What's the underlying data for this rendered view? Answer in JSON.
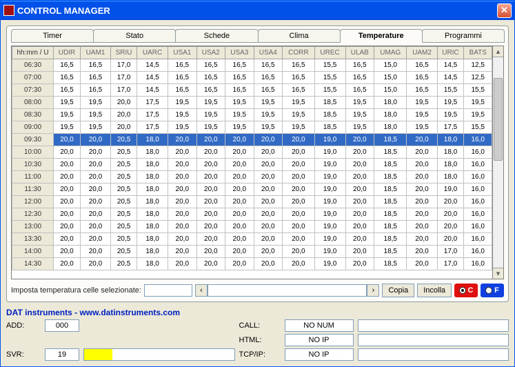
{
  "window": {
    "title": "CONTROL MANAGER"
  },
  "tabs": [
    "Timer",
    "Stato",
    "Schede",
    "Clima",
    "Temperature",
    "Programmi"
  ],
  "active_tab": 4,
  "columns": [
    "hh:mm / U",
    "UDIR",
    "UAM1",
    "SRIU",
    "UARC",
    "USA1",
    "USA2",
    "USA3",
    "USA4",
    "CORR",
    "UREC",
    "ULAB",
    "UMAG",
    "UAM2",
    "URIC",
    "BATS"
  ],
  "selected_row": 6,
  "rows": [
    {
      "t": "06:30",
      "v": [
        "16,5",
        "16,5",
        "17,0",
        "14,5",
        "16,5",
        "16,5",
        "16,5",
        "16,5",
        "16,5",
        "15,5",
        "16,5",
        "15,0",
        "16,5",
        "14,5",
        "12,5"
      ]
    },
    {
      "t": "07:00",
      "v": [
        "16,5",
        "16,5",
        "17,0",
        "14,5",
        "16,5",
        "16,5",
        "16,5",
        "16,5",
        "16,5",
        "15,5",
        "16,5",
        "15,0",
        "16,5",
        "14,5",
        "12,5"
      ]
    },
    {
      "t": "07:30",
      "v": [
        "16,5",
        "16,5",
        "17,0",
        "14,5",
        "16,5",
        "16,5",
        "16,5",
        "16,5",
        "16,5",
        "15,5",
        "16,5",
        "15,0",
        "16,5",
        "15,5",
        "15,5"
      ]
    },
    {
      "t": "08:00",
      "v": [
        "19,5",
        "19,5",
        "20,0",
        "17,5",
        "19,5",
        "19,5",
        "19,5",
        "19,5",
        "19,5",
        "18,5",
        "19,5",
        "18,0",
        "19,5",
        "19,5",
        "19,5"
      ]
    },
    {
      "t": "08:30",
      "v": [
        "19,5",
        "19,5",
        "20,0",
        "17,5",
        "19,5",
        "19,5",
        "19,5",
        "19,5",
        "19,5",
        "18,5",
        "19,5",
        "18,0",
        "19,5",
        "19,5",
        "19,5"
      ]
    },
    {
      "t": "09:00",
      "v": [
        "19,5",
        "19,5",
        "20,0",
        "17,5",
        "19,5",
        "19,5",
        "19,5",
        "19,5",
        "19,5",
        "18,5",
        "19,5",
        "18,0",
        "19,5",
        "17,5",
        "15,5"
      ]
    },
    {
      "t": "09:30",
      "v": [
        "20,0",
        "20,0",
        "20,5",
        "18,0",
        "20,0",
        "20,0",
        "20,0",
        "20,0",
        "20,0",
        "19,0",
        "20,0",
        "18,5",
        "20,0",
        "18,0",
        "16,0"
      ]
    },
    {
      "t": "10:00",
      "v": [
        "20,0",
        "20,0",
        "20,5",
        "18,0",
        "20,0",
        "20,0",
        "20,0",
        "20,0",
        "20,0",
        "19,0",
        "20,0",
        "18,5",
        "20,0",
        "18,0",
        "16,0"
      ]
    },
    {
      "t": "10:30",
      "v": [
        "20,0",
        "20,0",
        "20,5",
        "18,0",
        "20,0",
        "20,0",
        "20,0",
        "20,0",
        "20,0",
        "19,0",
        "20,0",
        "18,5",
        "20,0",
        "18,0",
        "16,0"
      ]
    },
    {
      "t": "11:00",
      "v": [
        "20,0",
        "20,0",
        "20,5",
        "18,0",
        "20,0",
        "20,0",
        "20,0",
        "20,0",
        "20,0",
        "19,0",
        "20,0",
        "18,5",
        "20,0",
        "18,0",
        "16,0"
      ]
    },
    {
      "t": "11:30",
      "v": [
        "20,0",
        "20,0",
        "20,5",
        "18,0",
        "20,0",
        "20,0",
        "20,0",
        "20,0",
        "20,0",
        "19,0",
        "20,0",
        "18,5",
        "20,0",
        "19,0",
        "16,0"
      ]
    },
    {
      "t": "12:00",
      "v": [
        "20,0",
        "20,0",
        "20,5",
        "18,0",
        "20,0",
        "20,0",
        "20,0",
        "20,0",
        "20,0",
        "19,0",
        "20,0",
        "18,5",
        "20,0",
        "20,0",
        "16,0"
      ]
    },
    {
      "t": "12:30",
      "v": [
        "20,0",
        "20,0",
        "20,5",
        "18,0",
        "20,0",
        "20,0",
        "20,0",
        "20,0",
        "20,0",
        "19,0",
        "20,0",
        "18,5",
        "20,0",
        "20,0",
        "16,0"
      ]
    },
    {
      "t": "13:00",
      "v": [
        "20,0",
        "20,0",
        "20,5",
        "18,0",
        "20,0",
        "20,0",
        "20,0",
        "20,0",
        "20,0",
        "19,0",
        "20,0",
        "18,5",
        "20,0",
        "20,0",
        "16,0"
      ]
    },
    {
      "t": "13:30",
      "v": [
        "20,0",
        "20,0",
        "20,5",
        "18,0",
        "20,0",
        "20,0",
        "20,0",
        "20,0",
        "20,0",
        "19,0",
        "20,0",
        "18,5",
        "20,0",
        "20,0",
        "16,0"
      ]
    },
    {
      "t": "14:00",
      "v": [
        "20,0",
        "20,0",
        "20,5",
        "18,0",
        "20,0",
        "20,0",
        "20,0",
        "20,0",
        "20,0",
        "19,0",
        "20,0",
        "18,5",
        "20,0",
        "17,0",
        "16,0"
      ]
    },
    {
      "t": "14:30",
      "v": [
        "20,0",
        "20,0",
        "20,5",
        "18,0",
        "20,0",
        "20,0",
        "20,0",
        "20,0",
        "20,0",
        "19,0",
        "20,0",
        "18,5",
        "20,0",
        "17,0",
        "16,0"
      ]
    }
  ],
  "bottom": {
    "label": "Imposta temperatura celle selezionate:",
    "copy": "Copia",
    "paste": "Incolla",
    "unit_c": "C",
    "unit_f": "F"
  },
  "footer": {
    "brand": "DAT instruments - www.datinstruments.com",
    "add_lbl": "ADD:",
    "add_val": "000",
    "svr_lbl": "SVR:",
    "svr_val": "19",
    "svr_pct": 19,
    "call_lbl": "CALL:",
    "call_val": "NO NUM",
    "html_lbl": "HTML:",
    "html_val": "NO IP",
    "tcp_lbl": "TCP/IP:",
    "tcp_val": "NO IP"
  }
}
